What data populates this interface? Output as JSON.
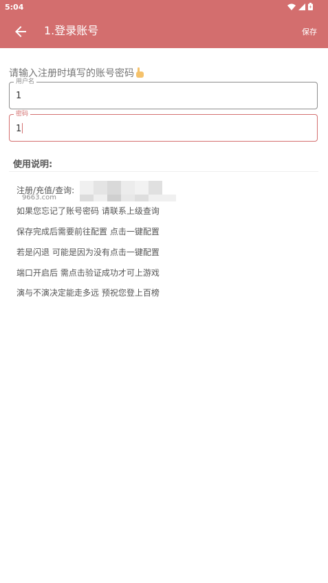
{
  "status_bar": {
    "time": "5:04"
  },
  "toolbar": {
    "title": "1.登录账号",
    "save_label": "保存"
  },
  "form": {
    "prompt": "请输入注册时填写的账号密码",
    "username": {
      "label": "用户名",
      "value": "1"
    },
    "password": {
      "label": "密码",
      "value": "1"
    }
  },
  "instructions": {
    "title": "使用说明:",
    "lines": [
      "注册/充值/查询:",
      "如果您忘记了账号密码 请联系上级查询",
      "保存完成后需要前往配置 点击一键配置",
      "若是闪退 可能是因为没有点击一键配置",
      "端口开启后 需点击验证成功才可上游戏",
      "演与不演决定能走多远 预祝您登上百榜"
    ],
    "watermark": "9663.com"
  },
  "colors": {
    "accent": "#D36E6E",
    "text": "#333333",
    "muted": "#757575"
  },
  "icons": [
    "back-arrow-icon",
    "wifi-icon",
    "signal-icon",
    "battery-icon",
    "pointing-hand-icon"
  ]
}
